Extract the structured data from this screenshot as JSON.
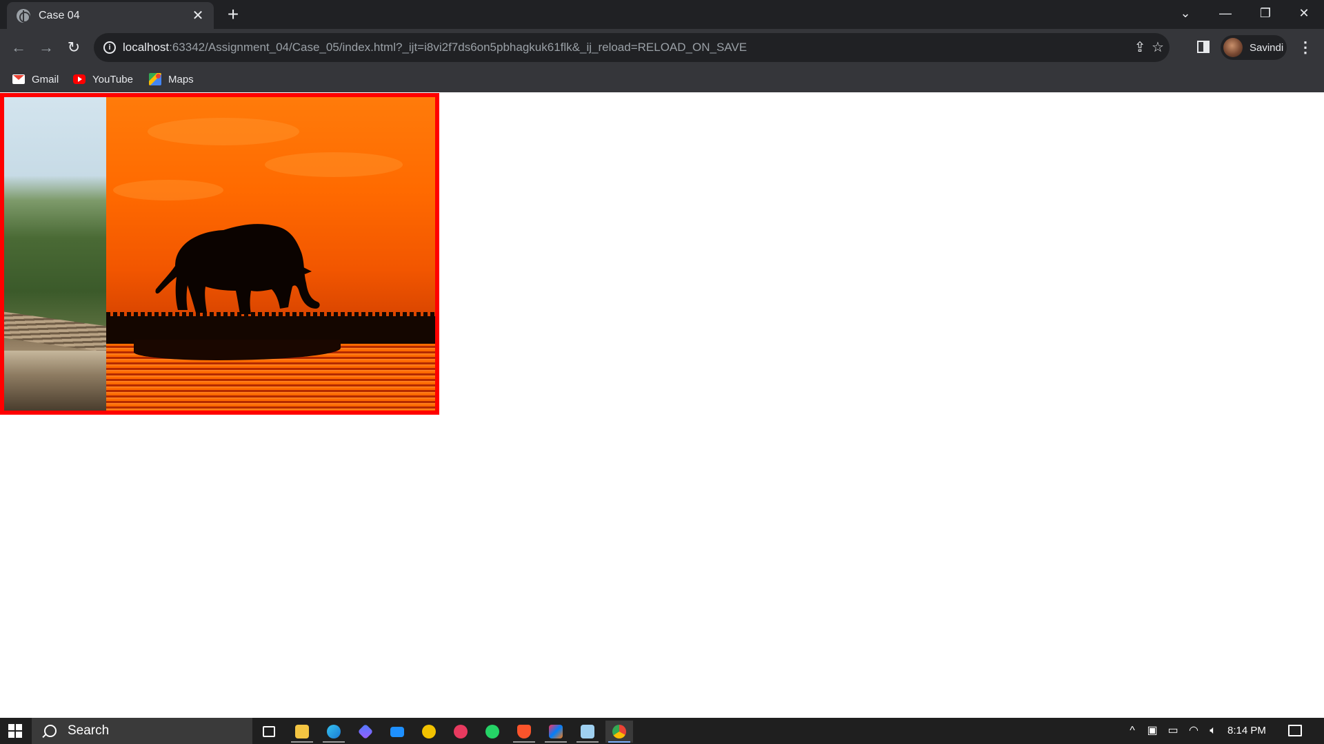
{
  "window": {
    "tab_title": "Case 04",
    "tab_close": "✕",
    "new_tab": "+",
    "controls": {
      "dropdown": "⌄",
      "minimize": "—",
      "restore": "❐",
      "close": "✕"
    }
  },
  "toolbar": {
    "back": "←",
    "forward": "→",
    "reload": "↻",
    "url_host": "localhost",
    "url_rest": ":63342/Assignment_04/Case_05/index.html?_ijt=i8vi2f7ds6on5pbhagkuk61flk&_ij_reload=RELOAD_ON_SAVE",
    "share": "⇪",
    "star": "☆",
    "menu": "⋮",
    "profile_name": "Savindi"
  },
  "bookmarks": [
    {
      "label": "Gmail",
      "icon": "gmail-icon"
    },
    {
      "label": "YouTube",
      "icon": "youtube-icon"
    },
    {
      "label": "Maps",
      "icon": "maps-icon"
    }
  ],
  "page": {
    "border_color": "#ff0000",
    "images": [
      {
        "subject": "forest-railway",
        "icon": "image"
      },
      {
        "subject": "elephant-sunset",
        "icon": "image"
      }
    ]
  },
  "taskbar": {
    "search_placeholder": "Search",
    "apps": [
      "task-view",
      "file-explorer",
      "edge",
      "copilot",
      "mail",
      "whatsapp-companion",
      "camera",
      "whatsapp",
      "brave",
      "intellij",
      "notepad",
      "chrome"
    ],
    "tray_expand": "^",
    "clock": "8:14 PM"
  }
}
